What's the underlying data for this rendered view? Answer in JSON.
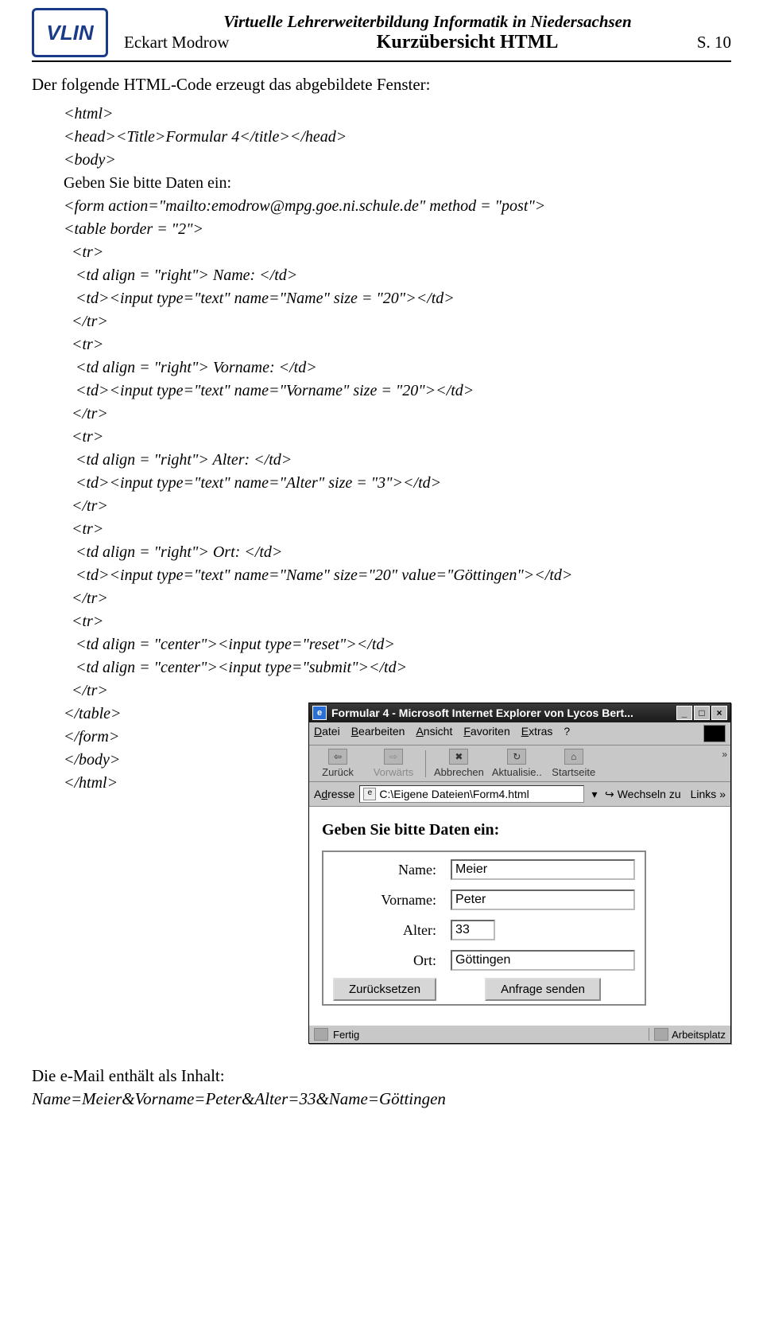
{
  "header": {
    "logo": "VLIN",
    "subtitle": "Virtuelle Lehrerweiterbildung Informatik in Niedersachsen",
    "author": "Eckart Modrow",
    "title": "Kurzübersicht HTML",
    "page": "S. 10"
  },
  "intro": "Der folgende HTML-Code erzeugt das abgebildete Fenster:",
  "code": {
    "l01": "<html>",
    "l02": "<head><Title>Formular 4</title></head>",
    "l03": "<body>",
    "l04": "Geben Sie bitte Daten ein:",
    "l05": "<form action=\"mailto:emodrow@mpg.goe.ni.schule.de\" method = \"post\">",
    "l06": "<table border = \"2\">",
    "l07": "  <tr>",
    "l08": "   <td align = \"right\"> Name: </td>",
    "l09": "   <td><input type=\"text\" name=\"Name\" size = \"20\"></td>",
    "l10": "  </tr>",
    "l11": "  <tr>",
    "l12": "   <td align = \"right\"> Vorname: </td>",
    "l13": "   <td><input type=\"text\" name=\"Vorname\" size = \"20\"></td>",
    "l14": "  </tr>",
    "l15": "  <tr>",
    "l16": "   <td align = \"right\"> Alter: </td>",
    "l17": "   <td><input type=\"text\" name=\"Alter\" size = \"3\"></td>",
    "l18": "  </tr>",
    "l19": "  <tr>",
    "l20": "   <td align = \"right\"> Ort: </td>",
    "l21": "   <td><input type=\"text\" name=\"Name\" size=\"20\" value=\"Göttingen\"></td>",
    "l22": "  </tr>",
    "l23": "  <tr>",
    "l24": "   <td align = \"center\"><input type=\"reset\"></td>",
    "l25": "   <td align = \"center\"><input type=\"submit\"></td>",
    "l26": "  </tr>",
    "l27": "</table>",
    "l28": "</form>",
    "l29": "</body>",
    "l30": "</html>"
  },
  "ie": {
    "title": "Formular 4 - Microsoft Internet Explorer von Lycos Bert...",
    "menu": {
      "datei": "Datei",
      "bearbeiten": "Bearbeiten",
      "ansicht": "Ansicht",
      "favoriten": "Favoriten",
      "extras": "Extras",
      "help": "?"
    },
    "toolbar": {
      "back": "Zurück",
      "forward": "Vorwärts",
      "stop": "Abbrechen",
      "refresh": "Aktualisie..",
      "home": "Startseite"
    },
    "address_label": "Adresse",
    "address_value": "C:\\Eigene Dateien\\Form4.html",
    "go": "Wechseln zu",
    "links": "Links",
    "content_prompt": "Geben Sie bitte Daten ein:",
    "fields": {
      "name_label": "Name:",
      "name_value": "Meier",
      "vorname_label": "Vorname:",
      "vorname_value": "Peter",
      "alter_label": "Alter:",
      "alter_value": "33",
      "ort_label": "Ort:",
      "ort_value": "Göttingen"
    },
    "buttons": {
      "reset": "Zurücksetzen",
      "submit": "Anfrage senden"
    },
    "status": {
      "done": "Fertig",
      "zone": "Arbeitsplatz"
    }
  },
  "outro": {
    "line1": "Die e-Mail enthält als Inhalt:",
    "line2": "Name=Meier&Vorname=Peter&Alter=33&Name=Göttingen"
  }
}
